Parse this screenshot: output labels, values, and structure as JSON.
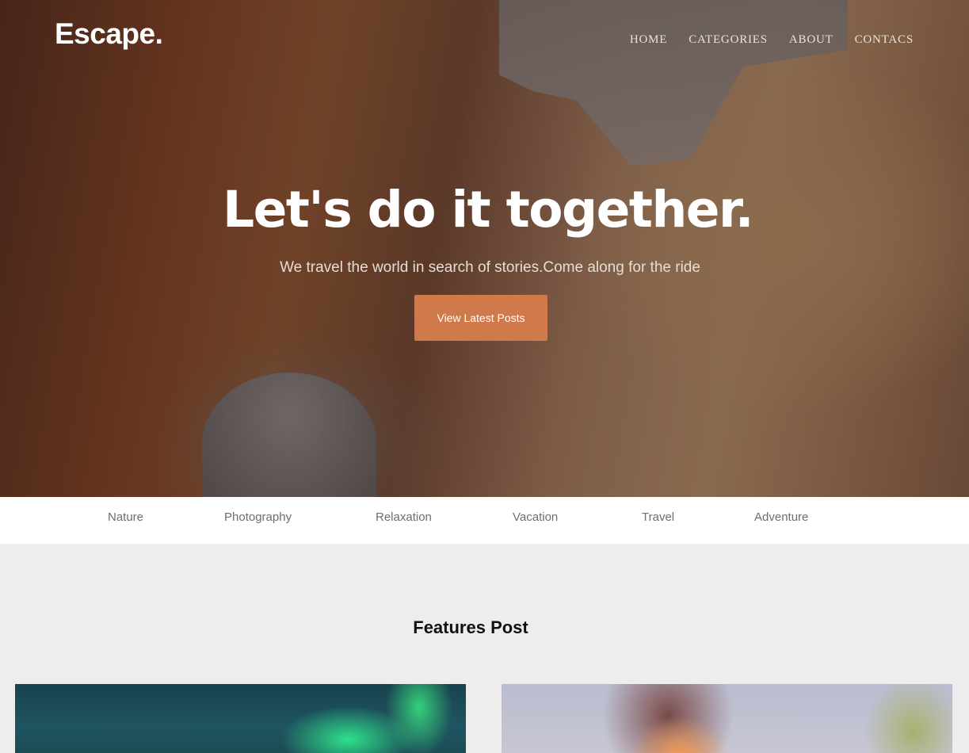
{
  "header": {
    "logo": "Escape.",
    "nav": [
      "HOME",
      "CATEGORIES",
      "ABOUT",
      "CONTACS"
    ]
  },
  "hero": {
    "title": "Let's do it together.",
    "subtitle": "We travel the world in search of stories.Come along for the ride",
    "button_label": "View Latest Posts",
    "button_color": "#d07a4b"
  },
  "categories": [
    "Nature",
    "Photography",
    "Relaxation",
    "Vacation",
    "Travel",
    "Adventure"
  ],
  "features": {
    "title": "Features Post"
  }
}
